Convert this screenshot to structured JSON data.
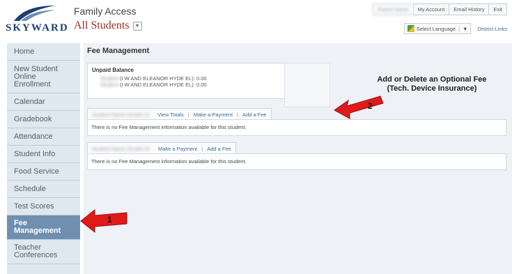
{
  "header": {
    "logo_text": "SKYWARD",
    "app_title": "Family Access",
    "student_select": "All Students",
    "top_links": {
      "my_account": "My Account",
      "email_history": "Email History",
      "exit": "Exit"
    },
    "language": "Select Language",
    "district_links": "District Links"
  },
  "sidebar": {
    "items": [
      {
        "label": "Home"
      },
      {
        "label": "New Student Online Enrollment"
      },
      {
        "label": "Calendar"
      },
      {
        "label": "Gradebook"
      },
      {
        "label": "Attendance"
      },
      {
        "label": "Student Info"
      },
      {
        "label": "Food Service"
      },
      {
        "label": "Schedule"
      },
      {
        "label": "Test Scores"
      },
      {
        "label": "Fee Management"
      },
      {
        "label": "Teacher Conferences"
      }
    ],
    "active": "Fee Management"
  },
  "main": {
    "title": "Fee Management",
    "unpaid": {
      "heading": "Unpaid Balance",
      "lines": [
        {
          "text": "(I W AND ELEANOR HYDE EL): 0.00"
        },
        {
          "text": "(I W AND ELEANOR HYDE EL): 0.00"
        }
      ]
    },
    "sections": [
      {
        "links": [
          "View Totals",
          "Make a Payment",
          "Add a Fee"
        ],
        "message": "There is no Fee Management information available for this student."
      },
      {
        "links": [
          "Make a Payment",
          "Add a Fee"
        ],
        "message": "There is no Fee Management information available for this student."
      }
    ]
  },
  "annotations": {
    "note": "Add or Delete an Optional Fee\n(Tech. Device Insurance)",
    "arrow1_number": "1",
    "arrow2_number": "2",
    "arrow_color": "#e01a1a"
  }
}
